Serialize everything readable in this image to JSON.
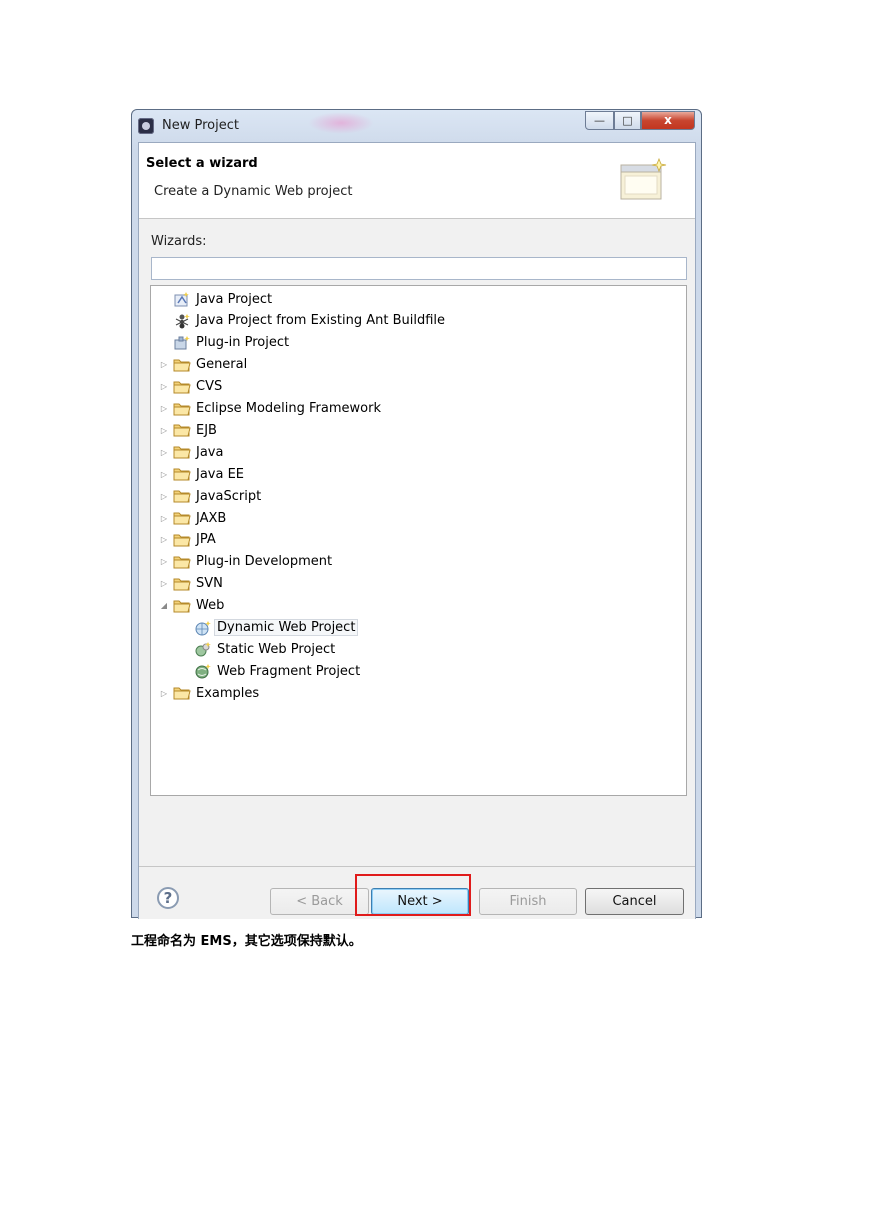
{
  "window": {
    "title": "New Project",
    "close_symbol": "x",
    "min_symbol": "—",
    "max_symbol": "□"
  },
  "banner": {
    "title": "Select a wizard",
    "description": "Create a Dynamic Web project"
  },
  "wizards": {
    "label": "Wizards:",
    "filter_value": ""
  },
  "tree": {
    "items": [
      {
        "label": "Java Project",
        "icon": "java-project-icon",
        "kind": "leaf"
      },
      {
        "label": "Java Project from Existing Ant Buildfile",
        "icon": "ant-icon",
        "kind": "leaf"
      },
      {
        "label": "Plug-in Project",
        "icon": "plugin-project-icon",
        "kind": "leaf"
      },
      {
        "label": "General",
        "icon": "folder-icon",
        "kind": "collapsed"
      },
      {
        "label": "CVS",
        "icon": "folder-icon",
        "kind": "collapsed"
      },
      {
        "label": "Eclipse Modeling Framework",
        "icon": "folder-icon",
        "kind": "collapsed"
      },
      {
        "label": "EJB",
        "icon": "folder-icon",
        "kind": "collapsed"
      },
      {
        "label": "Java",
        "icon": "folder-icon",
        "kind": "collapsed"
      },
      {
        "label": "Java EE",
        "icon": "folder-icon",
        "kind": "collapsed"
      },
      {
        "label": "JavaScript",
        "icon": "folder-icon",
        "kind": "collapsed"
      },
      {
        "label": "JAXB",
        "icon": "folder-icon",
        "kind": "collapsed"
      },
      {
        "label": "JPA",
        "icon": "folder-icon",
        "kind": "collapsed"
      },
      {
        "label": "Plug-in Development",
        "icon": "folder-icon",
        "kind": "collapsed"
      },
      {
        "label": "SVN",
        "icon": "folder-icon",
        "kind": "collapsed"
      },
      {
        "label": "Web",
        "icon": "folder-icon",
        "kind": "expanded"
      },
      {
        "label": "Dynamic Web Project",
        "icon": "dynamic-web-project-icon",
        "kind": "child",
        "selected": true
      },
      {
        "label": "Static Web Project",
        "icon": "static-web-project-icon",
        "kind": "child"
      },
      {
        "label": "Web Fragment Project",
        "icon": "web-fragment-project-icon",
        "kind": "child"
      },
      {
        "label": "Examples",
        "icon": "folder-icon",
        "kind": "collapsed"
      }
    ]
  },
  "buttons": {
    "help": "?",
    "back": "< Back",
    "next": "Next >",
    "finish": "Finish",
    "cancel": "Cancel"
  },
  "caption": "工程命名为 EMS，其它选项保持默认。",
  "colors": {
    "highlight_box": "#e01b1b",
    "selection": "#f5f7f9"
  }
}
